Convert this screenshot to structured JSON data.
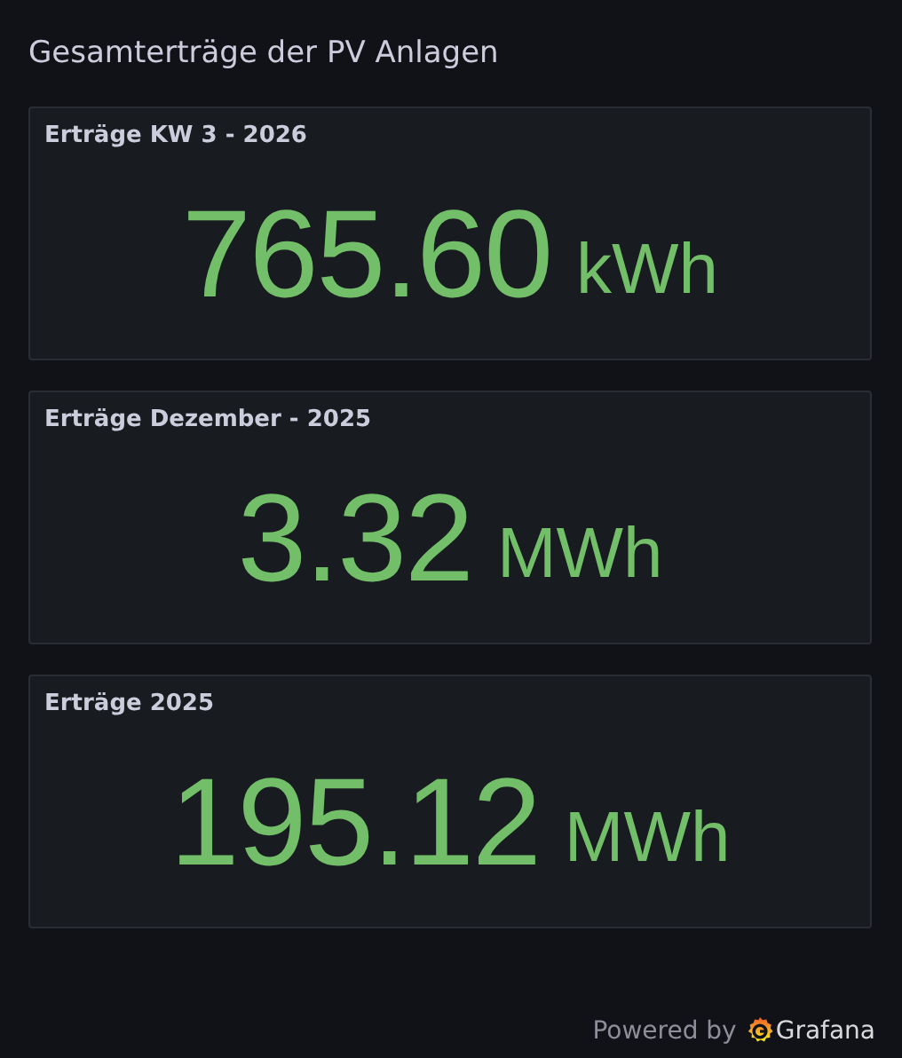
{
  "title": "Gesamterträge der PV Anlagen",
  "panels": [
    {
      "title": "Erträge KW 3 - 2026",
      "value": "765.60",
      "unit": "kWh"
    },
    {
      "title": "Erträge Dezember - 2025",
      "value": "3.32",
      "unit": "MWh"
    },
    {
      "title": "Erträge 2025",
      "value": "195.12",
      "unit": "MWh"
    }
  ],
  "footer": {
    "text": "Powered by",
    "brand": "Grafana"
  }
}
